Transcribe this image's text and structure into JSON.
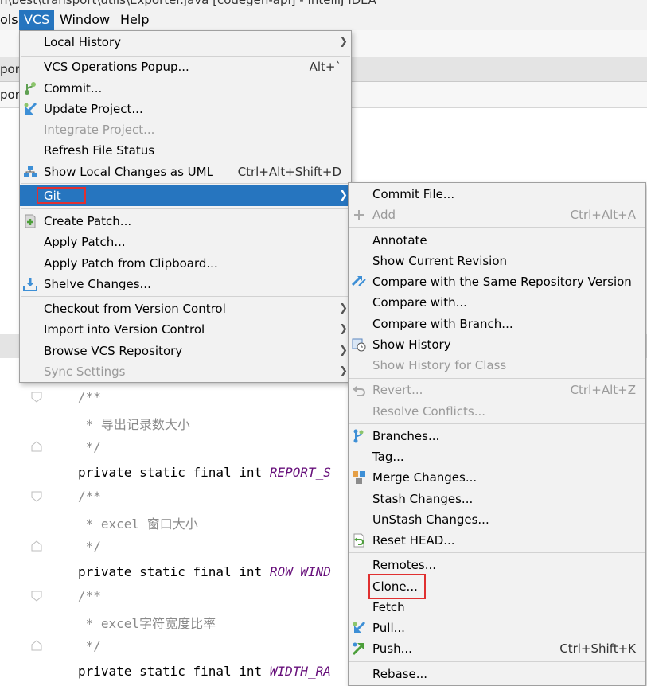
{
  "window": {
    "title": "n\\best\\transport\\utils\\Exporter.java [codegen-api] - IntelliJ IDEA"
  },
  "menubar": {
    "items": [
      {
        "label": "ols"
      },
      {
        "label": "VCS"
      },
      {
        "label": "Window"
      },
      {
        "label": "Help"
      }
    ]
  },
  "background": {
    "tab_fragment_1": "por",
    "tab_fragment_2": "por",
    "code": [
      "/**",
      " * 导出记录数大小",
      " */",
      "private static final int ",
      "REPORT_S",
      "/**",
      " * excel 窗口大小",
      " */",
      "private static final int ",
      "ROW_WIND",
      "/**",
      " * excel字符宽度比率",
      " */",
      "private static final int ",
      "WIDTH_RA"
    ]
  },
  "vcs_menu": {
    "items": [
      {
        "label": "Local History",
        "shortcut": "",
        "icon": ""
      },
      {
        "label": "VCS Operations Popup...",
        "shortcut": "Alt+`",
        "icon": ""
      },
      {
        "label": "Commit...",
        "shortcut": "",
        "icon": "commit-icon"
      },
      {
        "label": "Update Project...",
        "shortcut": "",
        "icon": "update-project-icon"
      },
      {
        "label": "Integrate Project...",
        "shortcut": "",
        "icon": ""
      },
      {
        "label": "Refresh File Status",
        "shortcut": "",
        "icon": ""
      },
      {
        "label": "Show Local Changes as UML",
        "shortcut": "Ctrl+Alt+Shift+D",
        "icon": "uml-icon"
      },
      {
        "label": "Git",
        "shortcut": "",
        "icon": ""
      },
      {
        "label": "Create Patch...",
        "shortcut": "",
        "icon": "create-patch-icon"
      },
      {
        "label": "Apply Patch...",
        "shortcut": "",
        "icon": ""
      },
      {
        "label": "Apply Patch from Clipboard...",
        "shortcut": "",
        "icon": ""
      },
      {
        "label": "Shelve Changes...",
        "shortcut": "",
        "icon": "shelve-icon"
      },
      {
        "label": "Checkout from Version Control",
        "shortcut": "",
        "icon": ""
      },
      {
        "label": "Import into Version Control",
        "shortcut": "",
        "icon": ""
      },
      {
        "label": "Browse VCS Repository",
        "shortcut": "",
        "icon": ""
      },
      {
        "label": "Sync Settings",
        "shortcut": "",
        "icon": ""
      }
    ]
  },
  "git_menu": {
    "items": [
      {
        "label": "Commit File...",
        "shortcut": "",
        "icon": ""
      },
      {
        "label": "Add",
        "shortcut": "Ctrl+Alt+A",
        "icon": "add-icon"
      },
      {
        "label": "Annotate",
        "shortcut": "",
        "icon": ""
      },
      {
        "label": "Show Current Revision",
        "shortcut": "",
        "icon": ""
      },
      {
        "label": "Compare with the Same Repository Version",
        "shortcut": "",
        "icon": "compare-icon"
      },
      {
        "label": "Compare with...",
        "shortcut": "",
        "icon": ""
      },
      {
        "label": "Compare with Branch...",
        "shortcut": "",
        "icon": ""
      },
      {
        "label": "Show History",
        "shortcut": "",
        "icon": "history-icon"
      },
      {
        "label": "Show History for Class",
        "shortcut": "",
        "icon": ""
      },
      {
        "label": "Revert...",
        "shortcut": "Ctrl+Alt+Z",
        "icon": "revert-icon"
      },
      {
        "label": "Resolve Conflicts...",
        "shortcut": "",
        "icon": ""
      },
      {
        "label": "Branches...",
        "shortcut": "",
        "icon": "branches-icon"
      },
      {
        "label": "Tag...",
        "shortcut": "",
        "icon": ""
      },
      {
        "label": "Merge Changes...",
        "shortcut": "",
        "icon": "merge-icon"
      },
      {
        "label": "Stash Changes...",
        "shortcut": "",
        "icon": ""
      },
      {
        "label": "UnStash Changes...",
        "shortcut": "",
        "icon": ""
      },
      {
        "label": "Reset HEAD...",
        "shortcut": "",
        "icon": "reset-head-icon"
      },
      {
        "label": "Remotes...",
        "shortcut": "",
        "icon": ""
      },
      {
        "label": "Clone...",
        "shortcut": "",
        "icon": ""
      },
      {
        "label": "Fetch",
        "shortcut": "",
        "icon": ""
      },
      {
        "label": "Pull...",
        "shortcut": "",
        "icon": "pull-icon"
      },
      {
        "label": "Push...",
        "shortcut": "Ctrl+Shift+K",
        "icon": "push-icon"
      },
      {
        "label": "Rebase...",
        "shortcut": "",
        "icon": ""
      }
    ]
  },
  "colors": {
    "selection": "#2675bf",
    "highlight_box": "#e03030",
    "menu_bg": "#f2f2f2"
  }
}
